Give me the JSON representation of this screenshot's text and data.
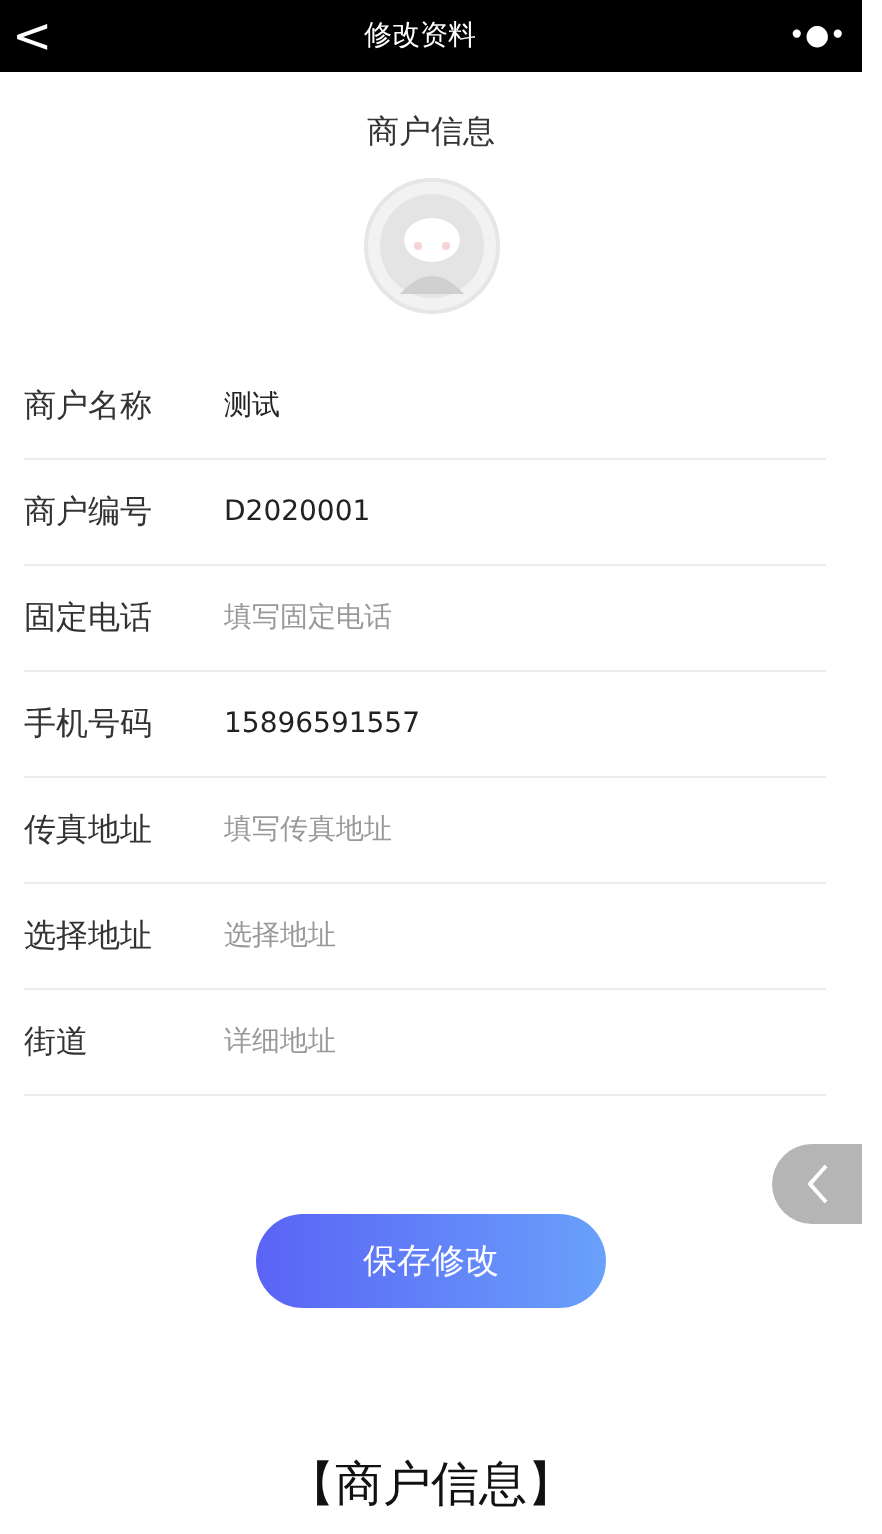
{
  "header": {
    "back": "<",
    "title": "修改资料",
    "more": "•●•"
  },
  "section_title": "商户信息",
  "fields": [
    {
      "label": "商户名称",
      "value": "测试"
    },
    {
      "label": "商户编号",
      "value": "D2020001"
    },
    {
      "label": "固定电话",
      "placeholder": "填写固定电话"
    },
    {
      "label": "手机号码",
      "value": "15896591557"
    },
    {
      "label": "传真地址",
      "placeholder": "填写传真地址"
    },
    {
      "label": "选择地址",
      "placeholder": "选择地址"
    },
    {
      "label": "街道",
      "placeholder": "详细地址"
    }
  ],
  "save_button": "保存修改",
  "caption": "【商户信息】"
}
